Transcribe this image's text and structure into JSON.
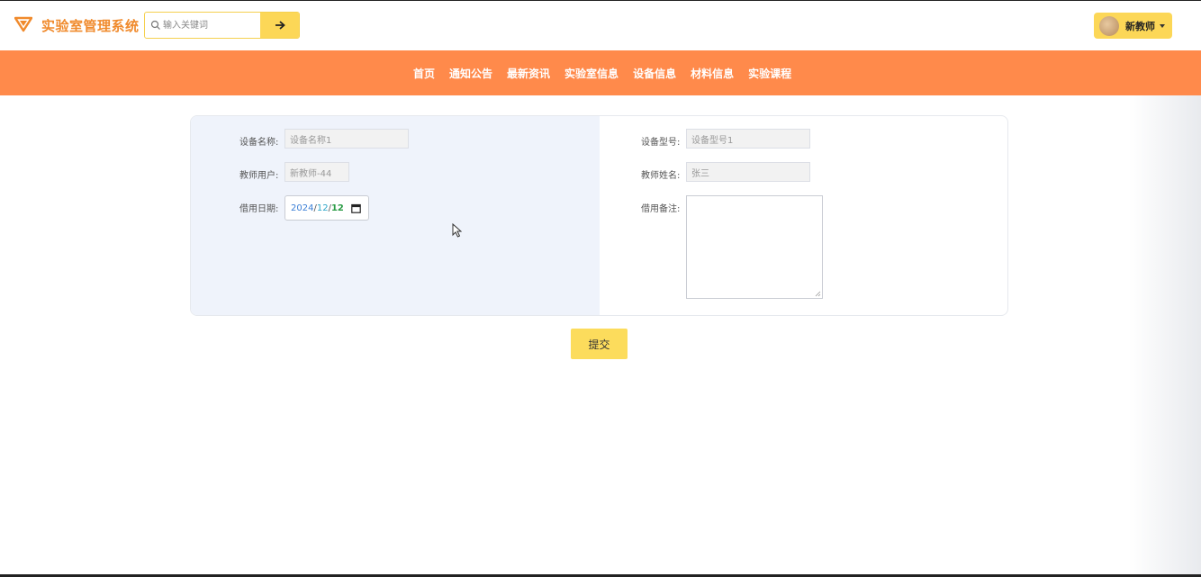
{
  "header": {
    "logo_text": "实验室管理系统",
    "search": {
      "placeholder": "输入关键词",
      "value": ""
    },
    "user_name": "新教师"
  },
  "nav": {
    "items": [
      "首页",
      "通知公告",
      "最新资讯",
      "实验室信息",
      "设备信息",
      "材料信息",
      "实验课程"
    ]
  },
  "form": {
    "device_name": {
      "label": "设备名称:",
      "value": "设备名称1"
    },
    "device_model": {
      "label": "设备型号:",
      "value": "设备型号1"
    },
    "teacher_user": {
      "label": "教师用户:",
      "value": "新教师-44"
    },
    "teacher_name": {
      "label": "教师姓名:",
      "value": "张三"
    },
    "borrow_date": {
      "label": "借用日期:",
      "year": "2024",
      "sep": "/",
      "month": "12",
      "day": "12"
    },
    "borrow_note": {
      "label": "借用备注:",
      "value": ""
    },
    "submit_label": "提交"
  },
  "colors": {
    "brand": "#f08a2c",
    "nav_bg": "#ff8a4b",
    "accent_yellow": "#fcd757",
    "form_left_bg": "#eff3fb"
  },
  "icons": {
    "logo": "triangle-logo-icon",
    "search": "search-icon",
    "search_submit": "arrow-right-icon",
    "calendar": "calendar-icon",
    "caret": "chevron-down-icon"
  }
}
